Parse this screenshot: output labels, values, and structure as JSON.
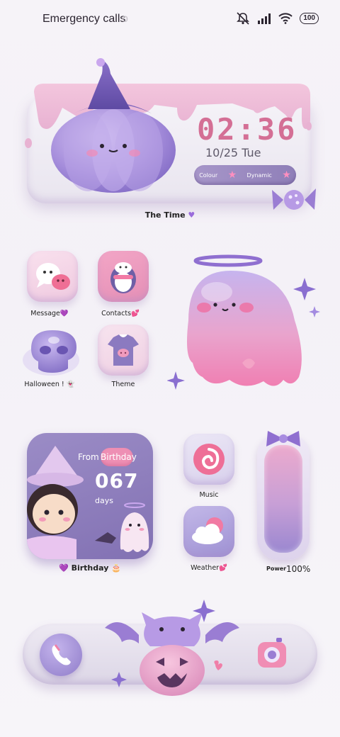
{
  "status_bar": {
    "carrier_text": "Emergency calls",
    "carrier_overflow": "o",
    "battery": "100",
    "icons": [
      "mute-bell-icon",
      "signal-icon",
      "wifi-icon",
      "battery-icon"
    ]
  },
  "clock_widget": {
    "time": "02:36",
    "date": "10/25 Tue",
    "left_chip": "Colour",
    "right_chip": "Dynamic",
    "label": "The Time"
  },
  "apps": [
    {
      "label": "Message",
      "suffix": "💜",
      "icon": "chat-bubbles-icon"
    },
    {
      "label": "Contacts",
      "suffix": "💕",
      "icon": "penguin-icon"
    },
    {
      "label": "Halloween ! ",
      "suffix": "👻",
      "icon": "skull-icon"
    },
    {
      "label": "Theme",
      "suffix": "",
      "icon": "tshirt-icon"
    },
    {
      "label": "Music",
      "suffix": "",
      "icon": "swirl-candy-icon"
    },
    {
      "label": "Weather",
      "suffix": "💕",
      "icon": "sun-cloud-icon"
    }
  ],
  "birthday_widget": {
    "from": "From",
    "pill": "Birthday",
    "days": "067",
    "days_unit": "days",
    "label": "Birthday",
    "label_prefix": "💜",
    "label_suffix": "🎂"
  },
  "power_widget": {
    "label": "Power",
    "value": "100%",
    "level": 1.0
  },
  "dock": {
    "items": [
      "phone-icon",
      "camera-icon"
    ]
  },
  "colors": {
    "accent_pink": "#d46f95",
    "lavender": "#9b8cc6",
    "background": "#f5f2f8"
  }
}
